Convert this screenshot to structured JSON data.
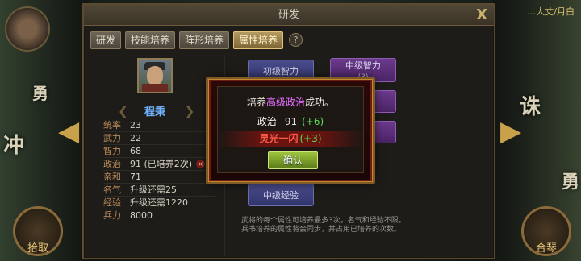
{
  "background": {
    "top_right_text": "…大丈/月白",
    "left_circle_label": "拾取",
    "right_circle_label": "合琴",
    "right_char_1": "诛",
    "right_char_2": "勇",
    "left_char_1": "冲",
    "left_char_2": "勇"
  },
  "panel": {
    "title": "研发",
    "close_label": "X",
    "tabs": [
      {
        "label": "研发",
        "active": false
      },
      {
        "label": "技能培养",
        "active": false
      },
      {
        "label": "阵形培养",
        "active": false
      },
      {
        "label": "属性培养",
        "active": true
      }
    ],
    "help_label": "?"
  },
  "general": {
    "name": "程秉",
    "stats": [
      {
        "label": "统率",
        "value": "23"
      },
      {
        "label": "武力",
        "value": "22"
      },
      {
        "label": "智力",
        "value": "68"
      },
      {
        "label": "政治",
        "value": "91 (已培养2次)",
        "has_reset": true
      },
      {
        "label": "亲和",
        "value": "71"
      },
      {
        "label": "名气",
        "value": "升级还需25"
      },
      {
        "label": "经验",
        "value": "升级还需1220"
      },
      {
        "label": "兵力",
        "value": "8000"
      }
    ],
    "reset_icon": "×"
  },
  "training": {
    "buttons": [
      {
        "label": "初级智力",
        "sub": ""
      },
      {
        "label": "中级智力",
        "sub": "(3)"
      },
      {
        "label": "中级经验",
        "sub": ""
      }
    ],
    "note_line1": "武将的每个属性可培养最多3次，名气和经验不限。",
    "note_line2": "兵书培养的属性将会同步，并占用已培养的次数。"
  },
  "modal": {
    "msg_prefix": "培养",
    "msg_highlight": "高级政治",
    "msg_suffix": "成功。",
    "attr_label": "政治",
    "attr_value": "91",
    "attr_gain": "(+6)",
    "bonus_label": "灵光一闪",
    "bonus_gain": "(+3)",
    "confirm_label": "确认"
  },
  "colors": {
    "accent_purple": "#e56cff",
    "gain_green": "#56e056",
    "bonus_red": "#ff5a4a",
    "name_blue": "#6fb4ff"
  }
}
